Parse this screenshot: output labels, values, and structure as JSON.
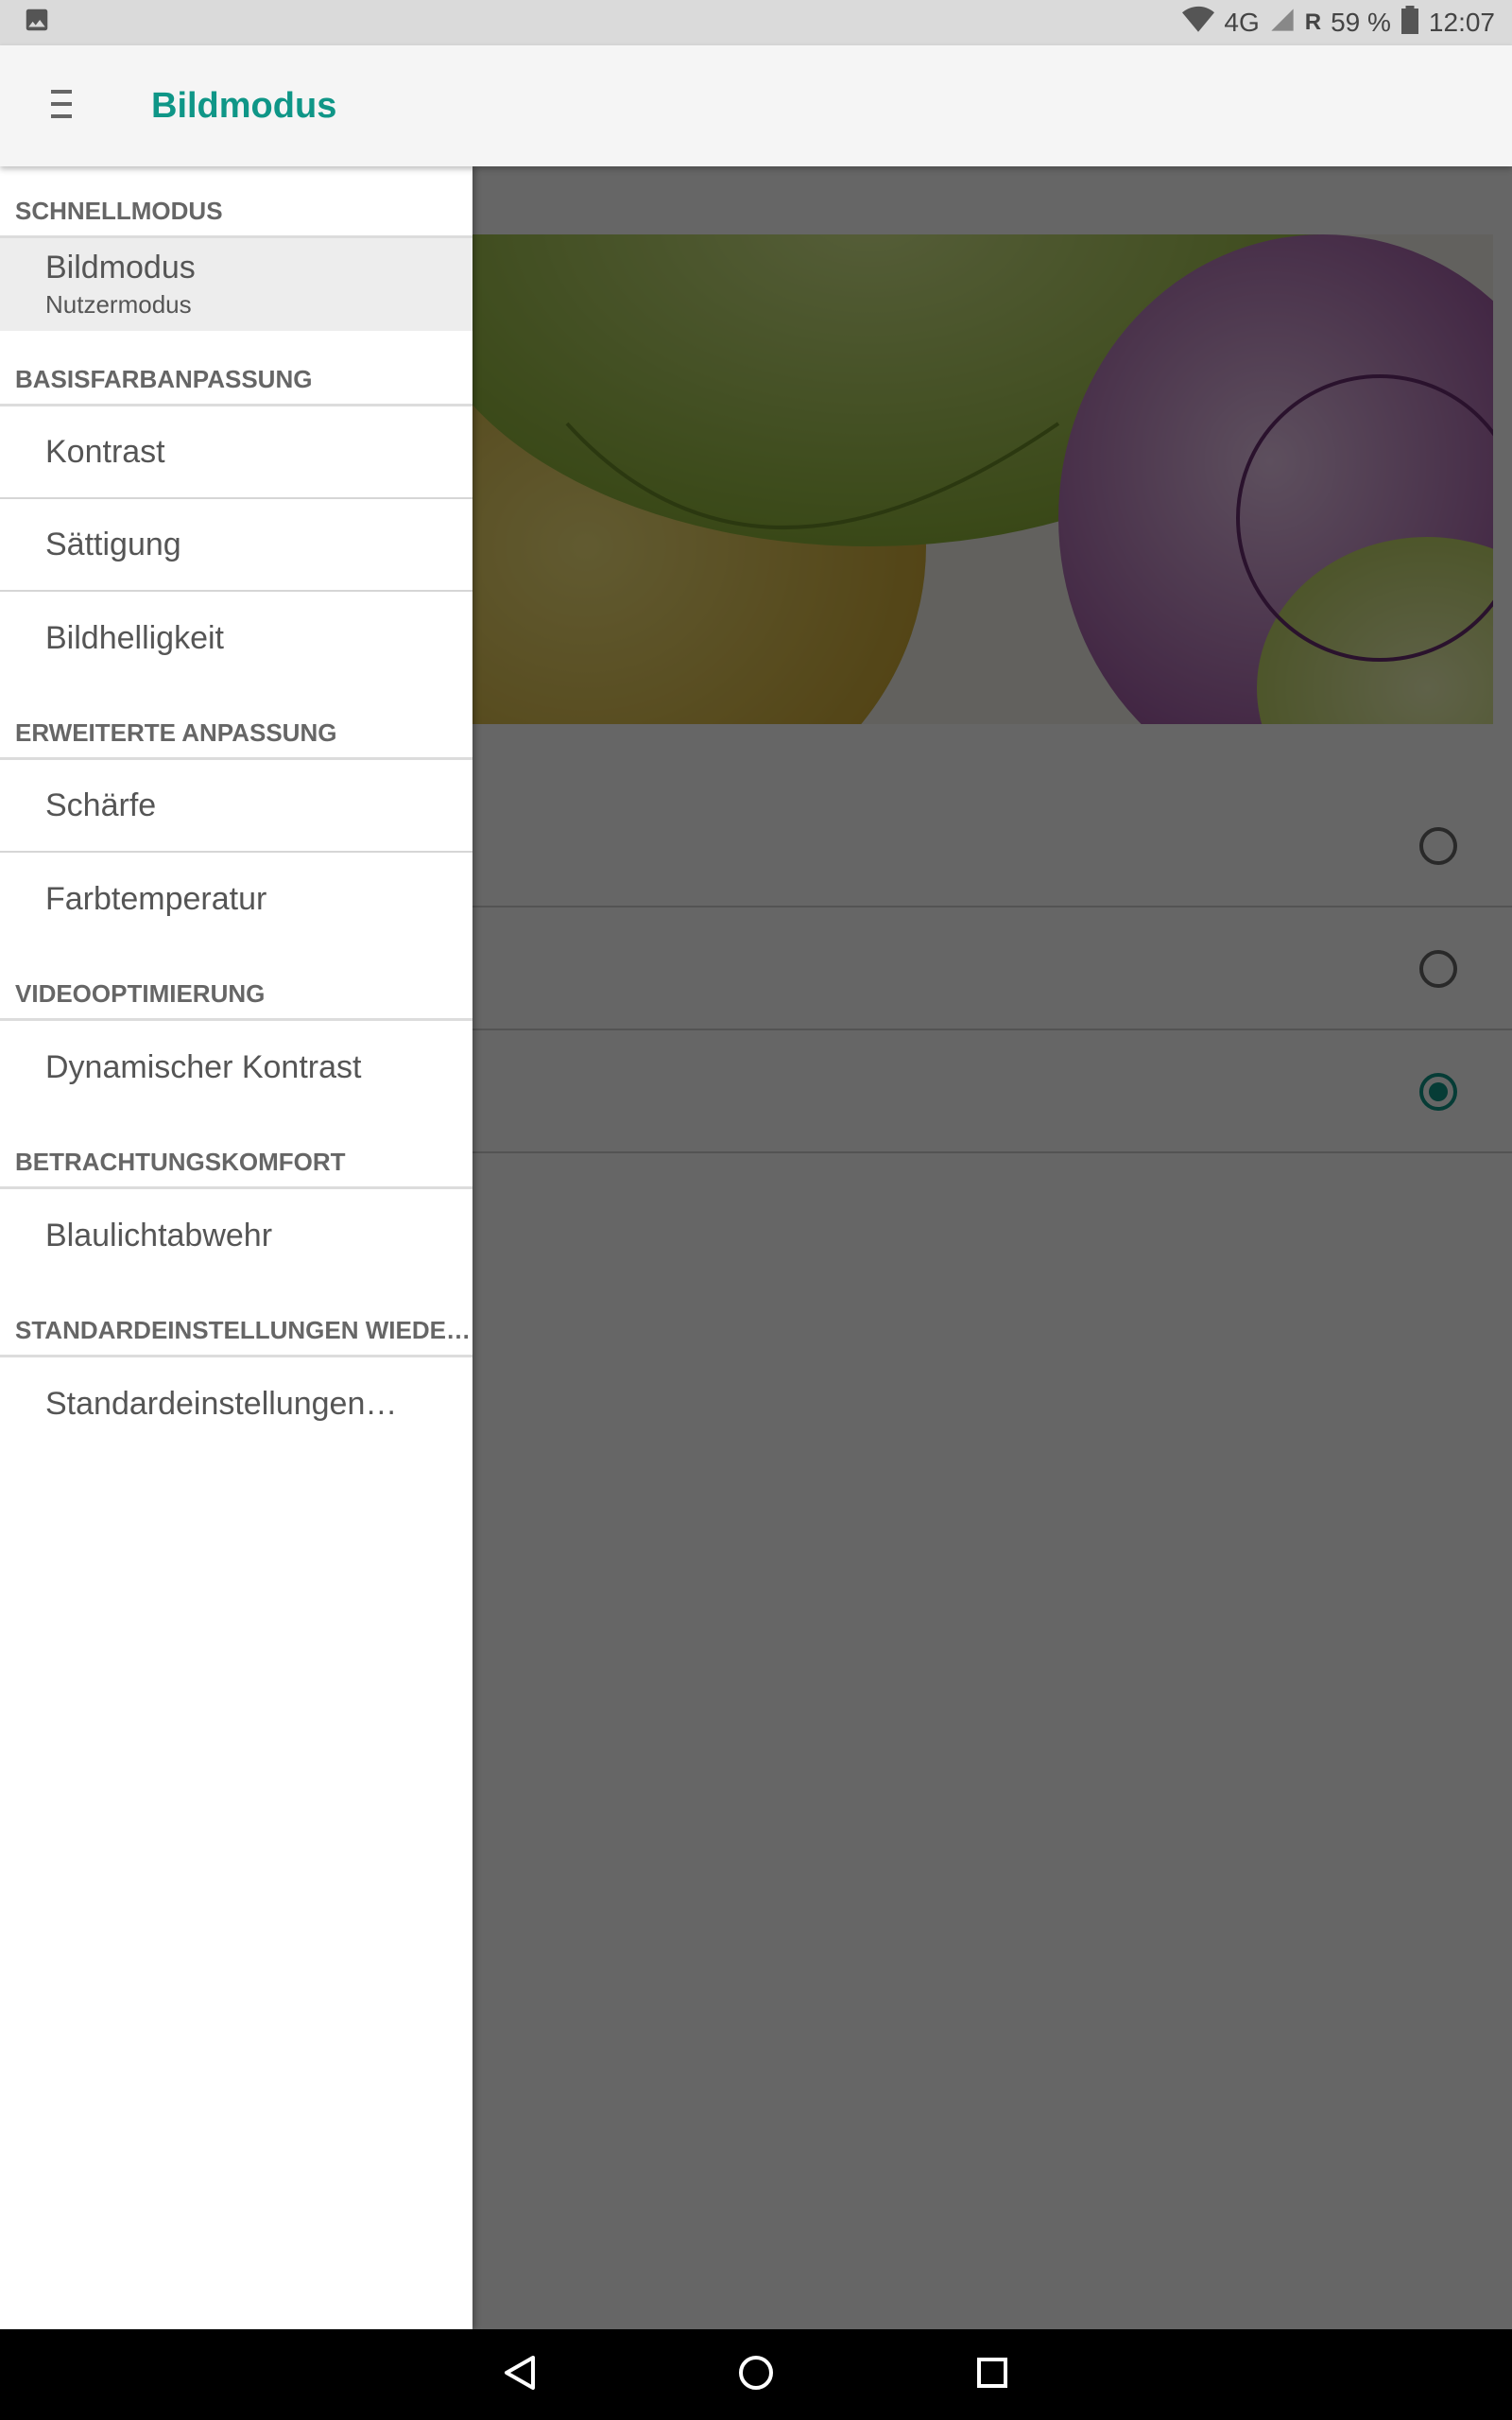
{
  "status_bar": {
    "network": "4G",
    "roaming": "R",
    "battery": "59 %",
    "time": "12:07",
    "icons": [
      "image-icon",
      "wifi-icon",
      "signal-icon",
      "battery-icon"
    ]
  },
  "app_bar": {
    "title": "Bildmodus",
    "menu_icon": "menu-icon"
  },
  "drawer": {
    "sections": [
      {
        "header": "SCHNELLMODUS",
        "items": [
          {
            "label": "Bildmodus",
            "subtitle": "Nutzermodus",
            "selected": true
          }
        ]
      },
      {
        "header": "BASISFARBANPASSUNG",
        "items": [
          {
            "label": "Kontrast"
          },
          {
            "label": "Sättigung"
          },
          {
            "label": "Bildhelligkeit"
          }
        ]
      },
      {
        "header": "ERWEITERTE ANPASSUNG",
        "items": [
          {
            "label": "Schärfe"
          },
          {
            "label": "Farbtemperatur"
          }
        ]
      },
      {
        "header": "VIDEOOPTIMIERUNG",
        "items": [
          {
            "label": "Dynamischer Kontrast"
          }
        ]
      },
      {
        "header": "BETRACHTUNGSKOMFORT",
        "items": [
          {
            "label": "Blaulichtabwehr"
          }
        ]
      },
      {
        "header": "STANDARDEINSTELLUNGEN WIEDE…",
        "items": [
          {
            "label": "Standardeinstellungen…"
          }
        ]
      }
    ]
  },
  "content": {
    "mode_options": [
      {
        "checked": false
      },
      {
        "checked": false
      },
      {
        "checked": true
      }
    ]
  },
  "colors": {
    "accent": "#0f9687",
    "status_bar": "#dadada",
    "app_bar": "#f5f5f5",
    "scrim": "rgba(0,0,0,0.6)",
    "nav_bar": "#000000"
  },
  "nav_bar": {
    "buttons": [
      "back-icon",
      "home-icon",
      "recents-icon"
    ]
  }
}
